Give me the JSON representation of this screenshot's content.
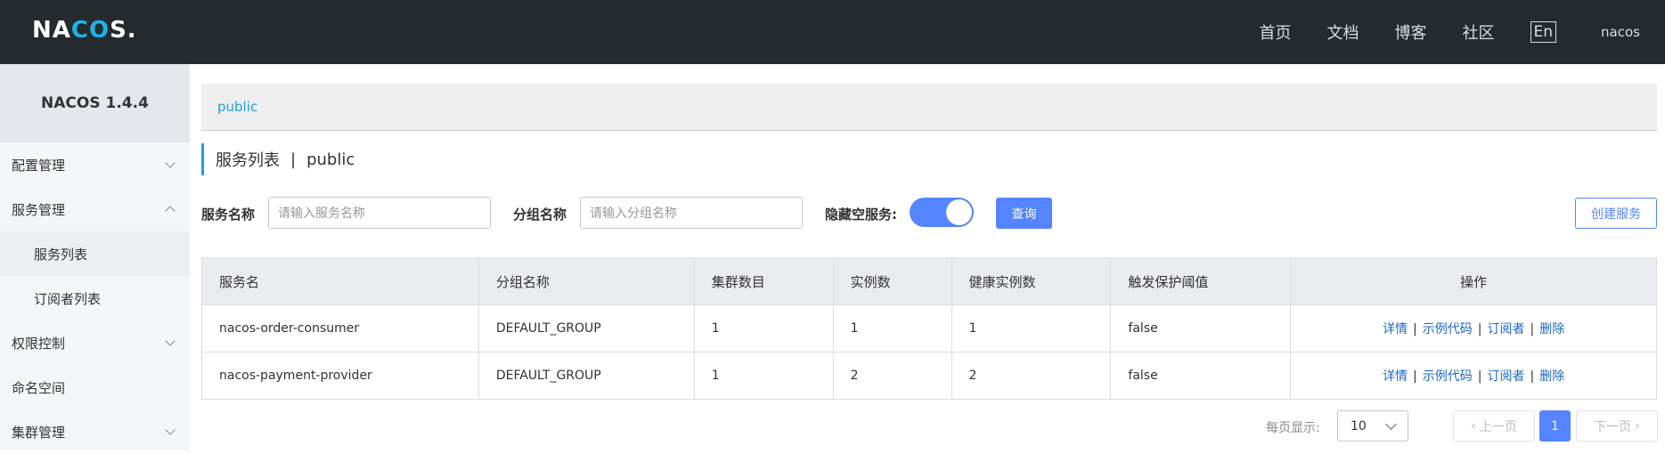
{
  "header": {
    "logo_pre": "NA",
    "logo_co": "CO",
    "logo_post": "S.",
    "nav": [
      "首页",
      "文档",
      "博客",
      "社区"
    ],
    "lang": "En",
    "user": "nacos"
  },
  "sidebar": {
    "version": "NACOS 1.4.4",
    "items": [
      {
        "label": "配置管理"
      },
      {
        "label": "服务管理"
      },
      {
        "label": "服务列表"
      },
      {
        "label": "订阅者列表"
      },
      {
        "label": "权限控制"
      },
      {
        "label": "命名空间"
      },
      {
        "label": "集群管理"
      }
    ]
  },
  "namespace": {
    "current": "public"
  },
  "page": {
    "title": "服务列表",
    "separator": "|",
    "namespace": "public"
  },
  "filters": {
    "service_label": "服务名称",
    "service_placeholder": "请输入服务名称",
    "group_label": "分组名称",
    "group_placeholder": "请输入分组名称",
    "hide_empty_label": "隐藏空服务:",
    "hide_empty_on": true,
    "query_button": "查询",
    "create_button": "创建服务"
  },
  "table": {
    "headers": [
      "服务名",
      "分组名称",
      "集群数目",
      "实例数",
      "健康实例数",
      "触发保护阈值",
      "操作"
    ],
    "rows": [
      {
        "name": "nacos-order-consumer",
        "group": "DEFAULT_GROUP",
        "clusters": "1",
        "instances": "1",
        "healthy": "1",
        "threshold": "false"
      },
      {
        "name": "nacos-payment-provider",
        "group": "DEFAULT_GROUP",
        "clusters": "1",
        "instances": "2",
        "healthy": "2",
        "threshold": "false"
      }
    ],
    "actions": [
      "详情",
      "示例代码",
      "订阅者",
      "删除"
    ],
    "action_sep": "|"
  },
  "pagination": {
    "page_size_label": "每页显示:",
    "page_size": "10",
    "prev": "上一页",
    "next": "下一页",
    "current": "1"
  },
  "colors": {
    "accent": "#5584ff",
    "topbar": "#252a2f",
    "link": "#1c68c5"
  }
}
